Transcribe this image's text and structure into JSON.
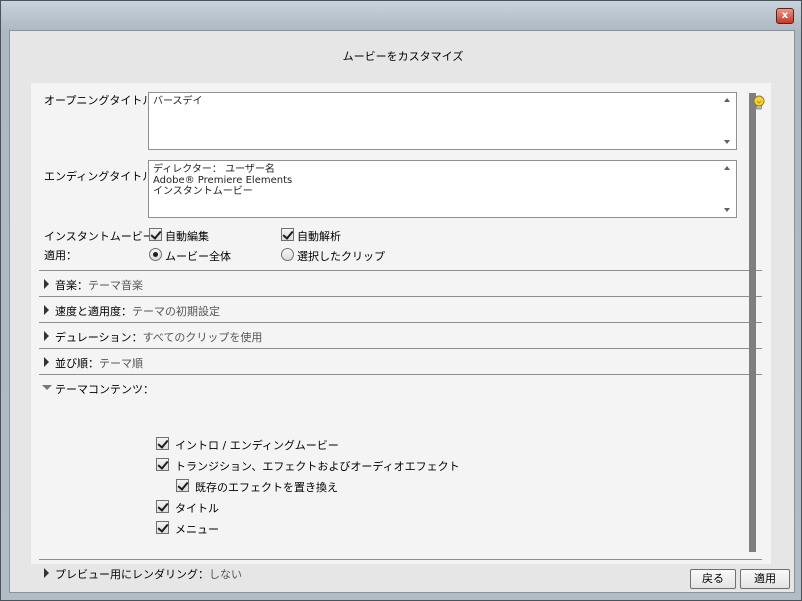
{
  "dialog": {
    "title": "ムービーをカスタマイズ",
    "close_label": "x"
  },
  "opening_title": {
    "label": "オープニングタイトル：",
    "value": "バースデイ"
  },
  "ending_title": {
    "label": "エンディングタイトル：",
    "lines": [
      "ディレクター： ユーザー名",
      "Adobe® Premiere Elements",
      "インスタントムービー"
    ]
  },
  "instant_movie": {
    "label": "インスタントムービー：",
    "auto_edit": "自動編集",
    "auto_analyze": "自動解析"
  },
  "apply": {
    "label": "適用：",
    "whole_movie": "ムービー全体",
    "selected_clips": "選択したクリップ"
  },
  "sections": [
    {
      "title": "音楽",
      "value": "テーマ音楽"
    },
    {
      "title": "速度と適用度",
      "value": "テーマの初期設定"
    },
    {
      "title": "デュレーション",
      "value": "すべてのクリップを使用"
    },
    {
      "title": "並び順",
      "value": "テーマ順"
    }
  ],
  "theme_contents": {
    "title": "テーマコンテンツ：",
    "items": [
      "イントロ / エンディングムービー",
      "トランジション、エフェクトおよびオーディオエフェクト",
      "既存のエフェクトを置き換え",
      "タイトル",
      "メニュー"
    ]
  },
  "render_preview": {
    "title": "プレビュー用にレンダリング",
    "value": "しない"
  },
  "buttons": {
    "back": "戻る",
    "apply": "適用"
  },
  "colors": {
    "frame": "#b2bcc6",
    "panel": "#f4f4f4",
    "close": "#c0392b"
  }
}
